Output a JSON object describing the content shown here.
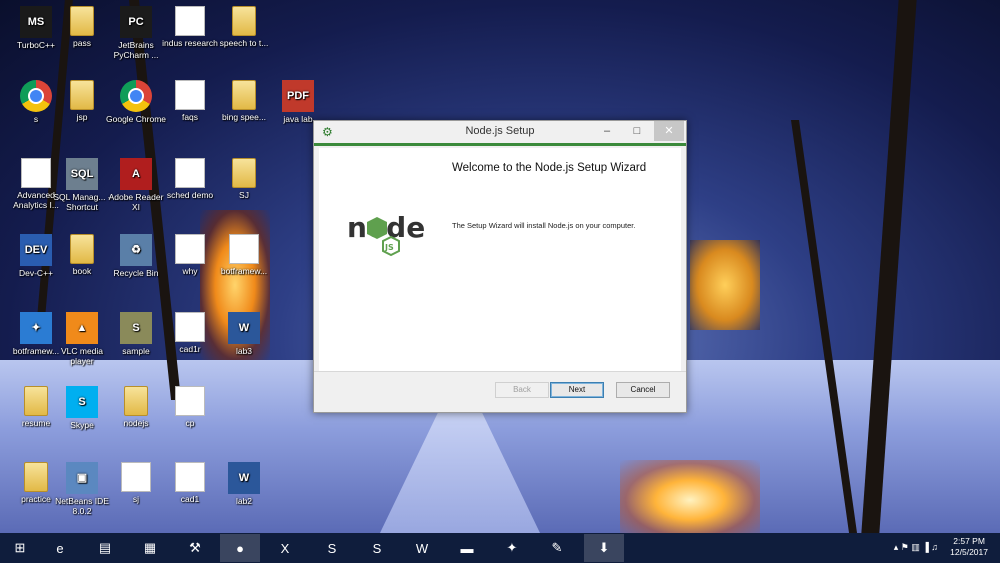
{
  "desktop": {
    "icons": [
      {
        "label": "TurboC++",
        "type": "app",
        "glyph": "MS",
        "color": "#1a1a1a"
      },
      {
        "label": "pass",
        "type": "folder"
      },
      {
        "label": "JetBrains PyCharm ...",
        "type": "app",
        "glyph": "PC",
        "color": "#1b1b1b"
      },
      {
        "label": "indus research",
        "type": "doc"
      },
      {
        "label": "speech to t...",
        "type": "folder"
      },
      {
        "label": "s",
        "type": "chrome"
      },
      {
        "label": "jsp",
        "type": "folder"
      },
      {
        "label": "Google Chrome",
        "type": "chrome"
      },
      {
        "label": "faqs",
        "type": "doc"
      },
      {
        "label": "bing spee...",
        "type": "folder"
      },
      {
        "label": "java lab",
        "type": "app",
        "glyph": "PDF",
        "color": "#c0392b"
      },
      {
        "label": "Advanced Analytics I...",
        "type": "doc"
      },
      {
        "label": "SQL Manag... - Shortcut",
        "type": "app",
        "glyph": "SQL",
        "color": "#6d7f8f"
      },
      {
        "label": "Adobe Reader XI",
        "type": "app",
        "glyph": "A",
        "color": "#b01e1e"
      },
      {
        "label": "sched demo",
        "type": "doc"
      },
      {
        "label": "SJ",
        "type": "folder"
      },
      {
        "label": "Dev-C++",
        "type": "app",
        "glyph": "DEV",
        "color": "#2a5db0"
      },
      {
        "label": "book",
        "type": "folder"
      },
      {
        "label": "Recycle Bin",
        "type": "app",
        "glyph": "♻",
        "color": "#5a7fa8"
      },
      {
        "label": "why",
        "type": "doc"
      },
      {
        "label": "botframew...",
        "type": "doc"
      },
      {
        "label": "botframew...",
        "type": "app",
        "glyph": "✦",
        "color": "#2b7cd3"
      },
      {
        "label": "VLC media player",
        "type": "app",
        "glyph": "▲",
        "color": "#f08a1a"
      },
      {
        "label": "sample",
        "type": "app",
        "glyph": "S",
        "color": "#8a8a5a"
      },
      {
        "label": "cad1r",
        "type": "doc"
      },
      {
        "label": "lab3",
        "type": "app",
        "glyph": "W",
        "color": "#2b579a"
      },
      {
        "label": "resume",
        "type": "folder"
      },
      {
        "label": "Skype",
        "type": "app",
        "glyph": "S",
        "color": "#00aff0"
      },
      {
        "label": "nodejs",
        "type": "folder"
      },
      {
        "label": "cp",
        "type": "doc"
      },
      {
        "label": "practice",
        "type": "folder"
      },
      {
        "label": "NetBeans IDE 8.0.2",
        "type": "app",
        "glyph": "▣",
        "color": "#5b88c0"
      },
      {
        "label": "sj",
        "type": "doc"
      },
      {
        "label": "cad1",
        "type": "doc"
      },
      {
        "label": "lab2",
        "type": "app",
        "glyph": "W",
        "color": "#2b579a"
      }
    ]
  },
  "window": {
    "title": "Node.js Setup",
    "minimize": "–",
    "maximize": "□",
    "close": "✕",
    "heading": "Welcome to the Node.js Setup Wizard",
    "description": "The Setup Wizard will install Node.js on your computer.",
    "logo_text": "node",
    "logo_sub": "JS",
    "buttons": {
      "back": "Back",
      "next": "Next",
      "cancel": "Cancel"
    }
  },
  "taskbar": {
    "items": [
      {
        "name": "start-icon",
        "glyph": "⊞",
        "active": false
      },
      {
        "name": "internet-explorer-icon",
        "glyph": "e",
        "active": false
      },
      {
        "name": "file-explorer-icon",
        "glyph": "▤",
        "active": false
      },
      {
        "name": "store-icon",
        "glyph": "▦",
        "active": false
      },
      {
        "name": "tools-icon",
        "glyph": "⚒",
        "active": false
      },
      {
        "name": "chrome-icon",
        "glyph": "●",
        "active": true
      },
      {
        "name": "excel-icon",
        "glyph": "X",
        "active": false
      },
      {
        "name": "sublime-icon",
        "glyph": "S",
        "active": false
      },
      {
        "name": "skype-icon",
        "glyph": "S",
        "active": false
      },
      {
        "name": "word-icon",
        "glyph": "W",
        "active": false
      },
      {
        "name": "cmd-icon",
        "glyph": "▬",
        "active": false
      },
      {
        "name": "bot-emulator-icon",
        "glyph": "✦",
        "active": false
      },
      {
        "name": "paint-icon",
        "glyph": "✎",
        "active": false
      },
      {
        "name": "installer-icon",
        "glyph": "⬇",
        "active": true
      }
    ],
    "tray_icons": "▴  ⚑  ▥  ▐  ♫",
    "time": "2:57 PM",
    "date": "12/5/2017"
  }
}
